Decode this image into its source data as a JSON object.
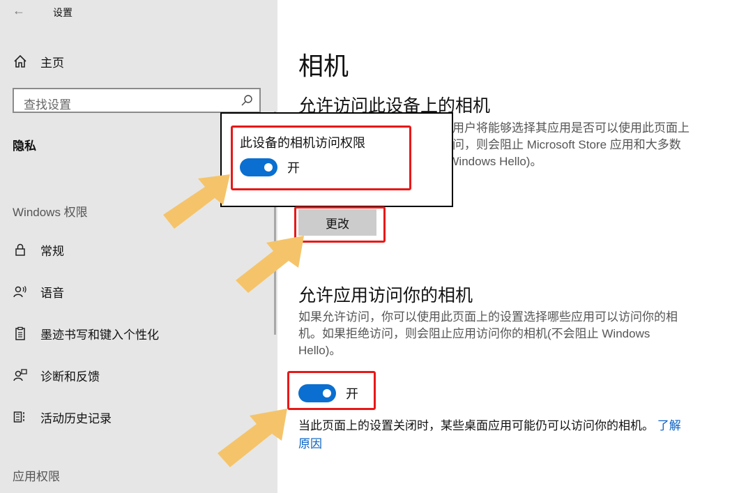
{
  "window": {
    "title": "设置"
  },
  "sidebar": {
    "home_label": "主页",
    "search_placeholder": "查找设置",
    "current_section": "隐私",
    "groups": [
      {
        "header": "Windows 权限"
      },
      {
        "header": "应用权限"
      }
    ],
    "items": [
      {
        "label": "常规",
        "icon": "lock-icon"
      },
      {
        "label": "语音",
        "icon": "speech-icon"
      },
      {
        "label": "墨迹书写和键入个性化",
        "icon": "clipboard-icon"
      },
      {
        "label": "诊断和反馈",
        "icon": "feedback-icon"
      },
      {
        "label": "活动历史记录",
        "icon": "timeline-icon"
      }
    ]
  },
  "main": {
    "page_title": "相机",
    "device_section": {
      "heading": "允许访问此设备上的相机",
      "description": "如果允许访问，使用此设备的用户将能够选择其应用是否可以使用此页面上的设置访问相机。如果拒绝访问，则会阻止 Microsoft Store 应用和大多数桌面应用访问相机(不会阻止 Windows Hello)。",
      "change_label": "更改"
    },
    "app_section": {
      "heading": "允许应用访问你的相机",
      "description": "如果允许访问，你可以使用此页面上的设置选择哪些应用可以访问你的相机。如果拒绝访问，则会阻止应用访问你的相机(不会阻止 Windows Hello)。",
      "toggle_state": "开",
      "toggle_on": true
    },
    "note_text": "当此页面上的设置关闭时，某些桌面应用可能仍可以访问你的相机。",
    "note_link": "了解原因"
  },
  "popup": {
    "title": "此设备的相机访问权限",
    "toggle_state": "开",
    "toggle_on": true
  },
  "colors": {
    "accent": "#0a6fd0",
    "highlight": "#e81818",
    "arrow": "#f5c46a",
    "link": "#0a62c4"
  }
}
